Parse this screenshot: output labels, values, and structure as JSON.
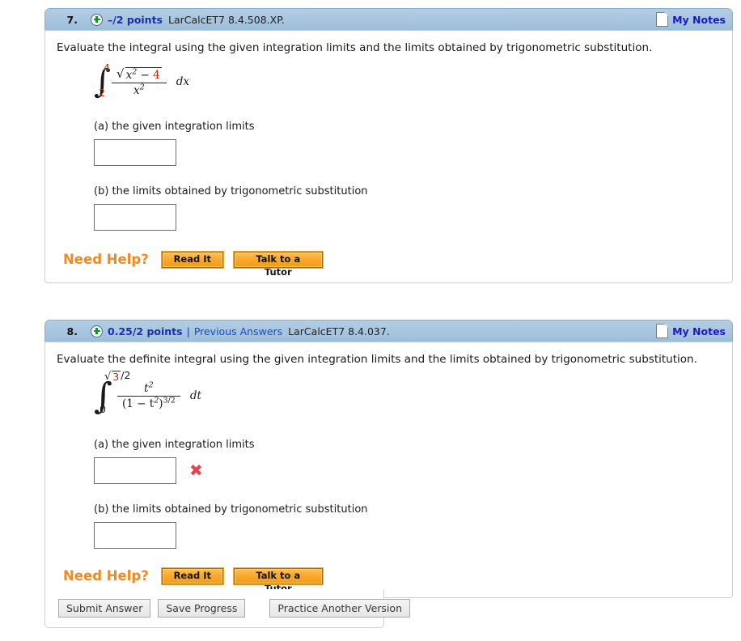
{
  "questions": [
    {
      "number": "7.",
      "points": "–/2 points",
      "has_previous": false,
      "separator": "|",
      "previous_answers": "",
      "code": "LarCalcET7 8.4.508.XP.",
      "notes_label": "My Notes",
      "prompt": "Evaluate the integral using the given integration limits and the limits obtained by trigonometric substitution.",
      "math": {
        "lower_limit": "2",
        "upper_limit": "4",
        "numerator_radicand_var": "x",
        "numerator_radicand_exp": "2",
        "numerator_minus": "−",
        "numerator_const": "4",
        "denominator_var": "x",
        "denominator_exp": "2",
        "differential": "dx"
      },
      "part_a_label": "(a) the given integration limits",
      "part_b_label": "(b) the limits obtained by trigonometric substitution",
      "part_a_value": "",
      "part_b_value": "",
      "part_a_mark": "",
      "need_help_label": "Need Help?",
      "read_it_label": "Read It",
      "tutor_label": "Talk to a Tutor"
    },
    {
      "number": "8.",
      "points": "0.25/2 points",
      "has_previous": true,
      "separator": "|",
      "previous_answers": "Previous Answers",
      "code": "LarCalcET7 8.4.037.",
      "notes_label": "My Notes",
      "prompt": "Evaluate the definite integral using the given integration limits and the limits obtained by trigonometric substitution.",
      "math": {
        "lower_limit": "0",
        "upper_limit_radicand": "3",
        "upper_limit_divisor": "/2",
        "numerator_var": "t",
        "numerator_exp": "2",
        "denominator": "(1 − t",
        "denominator_exp1": "2",
        "denominator_close": ")",
        "denominator_exp2": "3/2",
        "differential": "dt"
      },
      "part_a_label": "(a) the given integration limits",
      "part_b_label": "(b) the limits obtained by trigonometric substitution",
      "part_a_value": "",
      "part_b_value": "",
      "part_a_mark": "✖",
      "need_help_label": "Need Help?",
      "read_it_label": "Read It",
      "tutor_label": "Talk to a Tutor"
    }
  ],
  "submit_bar": {
    "submit_label": "Submit Answer",
    "save_label": "Save Progress",
    "practice_label": "Practice Another Version"
  },
  "colors": {
    "header_blue": "#a9c6e0",
    "points_blue": "#1b2fa8",
    "link_blue": "#1b49c4",
    "notes_blue": "#1b1bbb",
    "help_orange": "#f08a1e",
    "math_red": "#cc2200",
    "x_red": "#e8414a"
  }
}
